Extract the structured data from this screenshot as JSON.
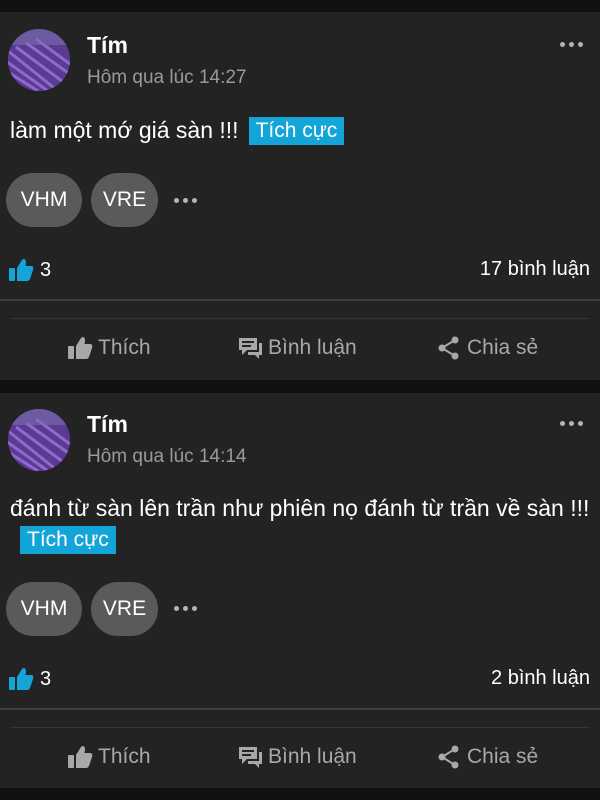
{
  "posts": [
    {
      "author": "Tím",
      "time": "Hôm qua lúc 14:27",
      "content": "làm một mớ giá sàn !!!",
      "sentiment": "Tích cực",
      "tags": [
        "VHM",
        "VRE"
      ],
      "likes": "3",
      "comments": "17 bình luận"
    },
    {
      "author": "Tím",
      "time": "Hôm qua lúc 14:14",
      "content": "đánh từ sàn lên trần như phiên nọ đánh từ trần về sàn !!!",
      "sentiment": "Tích cực",
      "tags": [
        "VHM",
        "VRE"
      ],
      "likes": "3",
      "comments": "2 bình luận"
    }
  ],
  "actions": {
    "like": "Thích",
    "comment": "Bình luận",
    "share": "Chia sẻ"
  },
  "icons": {
    "more": "more-horizontal-icon",
    "like_count": "thumbs-up-filled-icon",
    "like": "thumbs-up-icon",
    "comment": "comment-icon",
    "share": "share-icon"
  },
  "colors": {
    "background": "#111111",
    "card": "#232323",
    "accent": "#14a5d8",
    "tag": "#5a5a5a",
    "muted_text": "#9a9a9a"
  }
}
